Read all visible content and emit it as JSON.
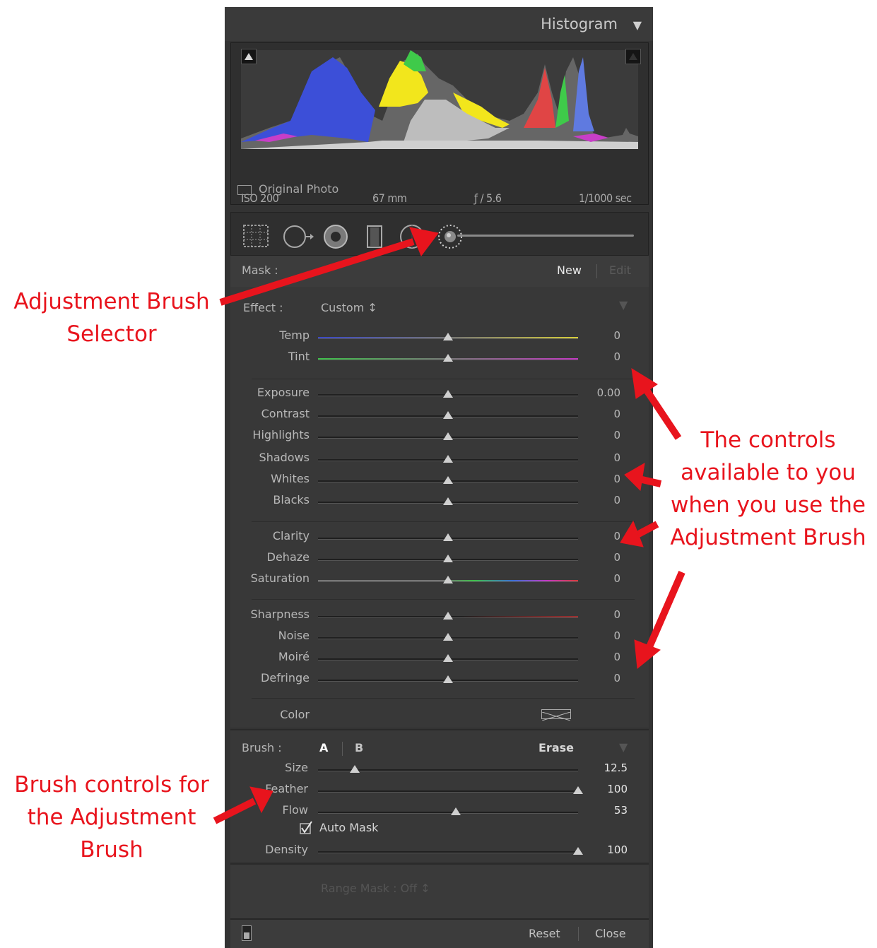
{
  "histogram": {
    "title": "Histogram",
    "exif": {
      "iso": "ISO 200",
      "focal": "67 mm",
      "aperture": "ƒ / 5.6",
      "shutter": "1/1000 sec"
    },
    "original_photo_label": "Original Photo"
  },
  "mask": {
    "label": "Mask :",
    "new": "New",
    "edit": "Edit"
  },
  "effect": {
    "label": "Effect :",
    "value": "Custom ↕",
    "sliders": [
      {
        "name": "temp",
        "label": "Temp",
        "value": "0",
        "level": 0.5
      },
      {
        "name": "tint",
        "label": "Tint",
        "value": "0",
        "level": 0.5
      },
      {
        "name": "exposure",
        "label": "Exposure",
        "value": "0.00",
        "level": 0.5
      },
      {
        "name": "contrast",
        "label": "Contrast",
        "value": "0",
        "level": 0.5
      },
      {
        "name": "highlights",
        "label": "Highlights",
        "value": "0",
        "level": 0.5
      },
      {
        "name": "shadows",
        "label": "Shadows",
        "value": "0",
        "level": 0.5
      },
      {
        "name": "whites",
        "label": "Whites",
        "value": "0",
        "level": 0.5
      },
      {
        "name": "blacks",
        "label": "Blacks",
        "value": "0",
        "level": 0.5
      },
      {
        "name": "clarity",
        "label": "Clarity",
        "value": "0",
        "level": 0.5
      },
      {
        "name": "dehaze",
        "label": "Dehaze",
        "value": "0",
        "level": 0.5
      },
      {
        "name": "saturation",
        "label": "Saturation",
        "value": "0",
        "level": 0.5
      },
      {
        "name": "sharpness",
        "label": "Sharpness",
        "value": "0",
        "level": 0.5
      },
      {
        "name": "noise",
        "label": "Noise",
        "value": "0",
        "level": 0.5
      },
      {
        "name": "moire",
        "label": "Moiré",
        "value": "0",
        "level": 0.5
      },
      {
        "name": "defringe",
        "label": "Defringe",
        "value": "0",
        "level": 0.5
      }
    ],
    "color_label": "Color"
  },
  "brush": {
    "label": "Brush :",
    "a": "A",
    "b": "B",
    "erase": "Erase",
    "sliders": [
      {
        "name": "size",
        "label": "Size",
        "value": "12.5",
        "level": 0.14
      },
      {
        "name": "feather",
        "label": "Feather",
        "value": "100",
        "level": 1.0
      },
      {
        "name": "flow",
        "label": "Flow",
        "value": "53",
        "level": 0.53
      }
    ],
    "auto_mask_label": "Auto Mask",
    "density": {
      "name": "density",
      "label": "Density",
      "value": "100",
      "level": 1.0
    }
  },
  "range_mask": "Range Mask : Off ↕",
  "footer": {
    "reset": "Reset",
    "close": "Close"
  },
  "annotations": {
    "selector": [
      "Adjustment Brush",
      "Selector"
    ],
    "controls": [
      "The controls",
      "available to you",
      "when you use the",
      "Adjustment Brush"
    ],
    "brush_controls": [
      "Brush controls for",
      "the Adjustment",
      "Brush"
    ]
  },
  "colors": {
    "annotation": "#e8141d",
    "panel": "#333333"
  }
}
